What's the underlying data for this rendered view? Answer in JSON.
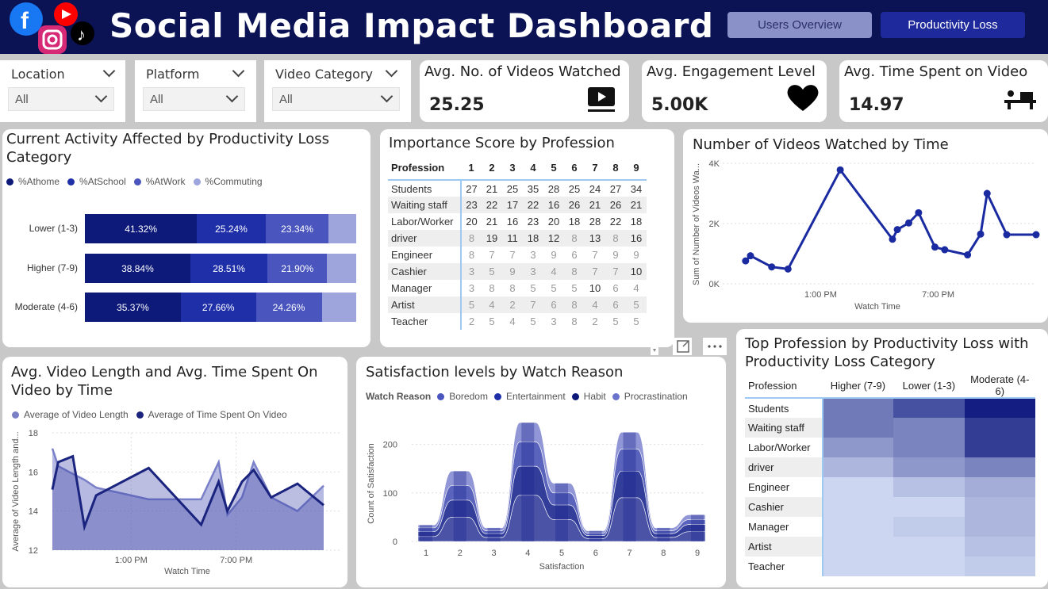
{
  "header": {
    "title": "Social Media Impact Dashboard",
    "nav": [
      "Users Overview",
      "Productivity Loss"
    ],
    "colors": {
      "bg": "#0b1355",
      "accent": "#1e2a9c"
    }
  },
  "filters": [
    {
      "label": "Location",
      "value": "All"
    },
    {
      "label": "Platform",
      "value": "All"
    },
    {
      "label": "Video Category",
      "value": "All"
    }
  ],
  "kpis": [
    {
      "title": "Avg. No. of Videos Watched",
      "value": "25.25",
      "icon": "video-play-icon"
    },
    {
      "title": "Avg. Engagement Level",
      "value": "5.00K",
      "icon": "heart-icon"
    },
    {
      "title": "Avg. Time Spent on Video",
      "value": "14.97",
      "icon": "desk-worker-icon"
    }
  ],
  "activity": {
    "title": "Current Activity Affected by Productivity Loss Category",
    "legend": [
      "%Athome",
      "%AtSchool",
      "%AtWork",
      "%Commuting"
    ],
    "chart_data": {
      "type": "bar",
      "orientation": "horizontal",
      "stacked": "100%",
      "categories": [
        "Lower (1-3)",
        "Higher (7-9)",
        "Moderate (4-6)"
      ],
      "series": [
        {
          "name": "%Athome",
          "values": [
            41.32,
            38.84,
            35.37
          ],
          "labels": [
            "41.32%",
            "38.84%",
            "35.37%"
          ]
        },
        {
          "name": "%AtSchool",
          "values": [
            25.24,
            28.51,
            27.66
          ],
          "labels": [
            "25.24%",
            "28.51%",
            "27.66%"
          ]
        },
        {
          "name": "%AtWork",
          "values": [
            23.34,
            21.9,
            24.26
          ],
          "labels": [
            "23.34%",
            "21.90%",
            "24.26%"
          ]
        },
        {
          "name": "%Commuting",
          "values": [
            10.1,
            10.75,
            12.71
          ]
        }
      ]
    }
  },
  "importance": {
    "title": "Importance Score by Profession",
    "header": [
      "Profession",
      "1",
      "2",
      "3",
      "4",
      "5",
      "6",
      "7",
      "8",
      "9"
    ],
    "rows": [
      [
        "Students",
        "27",
        "21",
        "25",
        "35",
        "28",
        "25",
        "24",
        "27",
        "34"
      ],
      [
        "Waiting staff",
        "23",
        "22",
        "17",
        "22",
        "16",
        "26",
        "21",
        "26",
        "21"
      ],
      [
        "Labor/Worker",
        "20",
        "21",
        "16",
        "23",
        "20",
        "18",
        "28",
        "22",
        "18"
      ],
      [
        "driver",
        "8",
        "19",
        "11",
        "18",
        "12",
        "8",
        "13",
        "8",
        "16"
      ],
      [
        "Engineer",
        "8",
        "7",
        "7",
        "3",
        "9",
        "6",
        "7",
        "9",
        "9"
      ],
      [
        "Cashier",
        "3",
        "5",
        "9",
        "3",
        "4",
        "8",
        "7",
        "7",
        "10"
      ],
      [
        "Manager",
        "3",
        "8",
        "8",
        "5",
        "5",
        "5",
        "10",
        "6",
        "4"
      ],
      [
        "Artist",
        "5",
        "4",
        "2",
        "7",
        "6",
        "8",
        "4",
        "6",
        "5"
      ],
      [
        "Teacher",
        "2",
        "5",
        "4",
        "5",
        "3",
        "8",
        "2",
        "5",
        "5"
      ]
    ]
  },
  "videosByTime": {
    "title": "Number of Videos Watched by Time",
    "ylabel": "Sum of Number of Videos Wa...",
    "xlabel": "Watch Time",
    "yticks": [
      "0K",
      "2K",
      "4K"
    ],
    "xticks": [
      "1:00 PM",
      "7:00 PM"
    ],
    "chart_data": {
      "type": "line",
      "x": [
        "09:10",
        "09:25",
        "10:30",
        "11:20",
        "14:00",
        "16:40",
        "16:55",
        "17:30",
        "18:00",
        "18:50",
        "19:20",
        "20:30",
        "21:10",
        "21:30",
        "22:30",
        "24:00"
      ],
      "y": [
        760,
        930,
        560,
        490,
        3780,
        1480,
        1800,
        2020,
        2360,
        1220,
        1130,
        960,
        1650,
        3000,
        1630,
        1630
      ],
      "ylim": [
        0,
        4000
      ]
    }
  },
  "avgLength": {
    "title": "Avg. Video Length and Avg. Time Spent On Video by Time",
    "legend": [
      "Average of Video Length",
      "Average of Time Spent On Video"
    ],
    "ylabel": "Average of Video Length and...",
    "xlabel": "Watch Time",
    "yticks": [
      "12",
      "14",
      "16",
      "18"
    ],
    "xticks": [
      "1:00 PM",
      "7:00 PM"
    ],
    "chart_data": {
      "type": "area",
      "x": [
        "08:30",
        "08:50",
        "09:40",
        "10:20",
        "11:00",
        "14:00",
        "17:00",
        "18:00",
        "18:30",
        "19:20",
        "20:00",
        "21:00",
        "22:30",
        "24:00"
      ],
      "series": [
        {
          "name": "Average of Video Length",
          "values": [
            17.2,
            16.3,
            15.9,
            15.6,
            15.2,
            14.6,
            14.6,
            16.5,
            13.8,
            14.7,
            16.5,
            14.7,
            14.0,
            15.3
          ]
        },
        {
          "name": "Average of Time Spent On Video",
          "values": [
            15.1,
            16.5,
            16.8,
            13.2,
            14.8,
            16.2,
            13.3,
            15.5,
            14.0,
            15.5,
            16.1,
            14.7,
            15.4,
            14.3
          ]
        }
      ],
      "ylim": [
        12,
        18
      ]
    }
  },
  "satisfaction": {
    "title": "Satisfaction levels by Watch Reason",
    "legendTitle": "Watch Reason",
    "legend": [
      "Boredom",
      "Entertainment",
      "Habit",
      "Procrastination"
    ],
    "ylabel": "Count of Satisfaction",
    "xlabel": "Satisfaction",
    "yticks": [
      "0",
      "100",
      "200"
    ],
    "chart_data": {
      "type": "area",
      "stacked": true,
      "categories": [
        "1",
        "2",
        "3",
        "4",
        "5",
        "6",
        "7",
        "8",
        "9"
      ],
      "series": [
        {
          "name": "Boredom",
          "values": [
            10,
            50,
            8,
            95,
            45,
            6,
            90,
            8,
            20
          ]
        },
        {
          "name": "Entertainment",
          "values": [
            10,
            35,
            8,
            60,
            30,
            6,
            55,
            8,
            15
          ]
        },
        {
          "name": "Habit",
          "values": [
            8,
            30,
            6,
            50,
            25,
            5,
            45,
            6,
            10
          ]
        },
        {
          "name": "Procrastination",
          "values": [
            6,
            30,
            6,
            40,
            20,
            5,
            35,
            6,
            10
          ]
        }
      ],
      "ylim": [
        0,
        250
      ]
    }
  },
  "topProfession": {
    "title": "Top Profession by Productivity Loss with Productivity Loss Category",
    "header": [
      "Profession",
      "Higher (7-9)",
      "Lower (1-3)",
      "Moderate (4-6)"
    ],
    "chart_data": {
      "type": "heatmap",
      "rows": [
        "Students",
        "Waiting staff",
        "Labor/Worker",
        "driver",
        "Engineer",
        "Cashier",
        "Manager",
        "Artist",
        "Teacher"
      ],
      "columns": [
        "Higher (7-9)",
        "Lower (1-3)",
        "Moderate (4-6)"
      ],
      "values": [
        [
          0.55,
          0.75,
          1.0
        ],
        [
          0.55,
          0.5,
          0.85
        ],
        [
          0.4,
          0.5,
          0.85
        ],
        [
          0.25,
          0.4,
          0.5
        ],
        [
          0.1,
          0.2,
          0.3
        ],
        [
          0.1,
          0.1,
          0.25
        ],
        [
          0.1,
          0.15,
          0.25
        ],
        [
          0.1,
          0.1,
          0.2
        ],
        [
          0.1,
          0.1,
          0.15
        ]
      ]
    }
  }
}
